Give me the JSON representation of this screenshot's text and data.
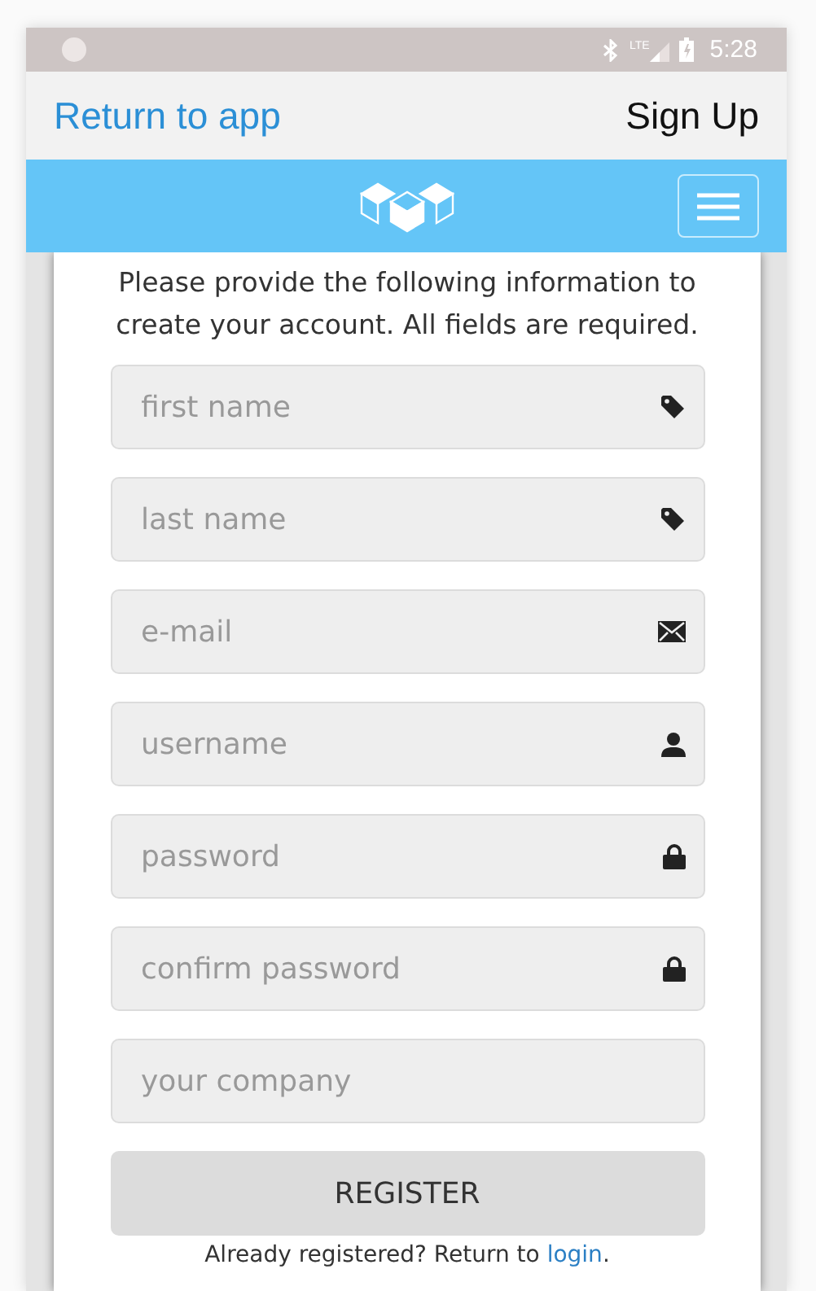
{
  "status_bar": {
    "time": "5:28",
    "network": "LTE"
  },
  "header": {
    "back_link": "Return to app",
    "title": "Sign Up"
  },
  "intro": "Please provide the following information to create your account. All fields are required.",
  "fields": [
    {
      "placeholder": "first name",
      "kind": "tag"
    },
    {
      "placeholder": "last name",
      "kind": "tag"
    },
    {
      "placeholder": "e-mail",
      "kind": "mail"
    },
    {
      "placeholder": "username",
      "kind": "user"
    },
    {
      "placeholder": "password",
      "kind": "lock"
    },
    {
      "placeholder": "confirm password",
      "kind": "lock"
    },
    {
      "placeholder": "your company",
      "kind": "none"
    }
  ],
  "register_button": "REGISTER",
  "footer": {
    "text": "Already registered? Return to ",
    "link": "login",
    "end": "."
  }
}
